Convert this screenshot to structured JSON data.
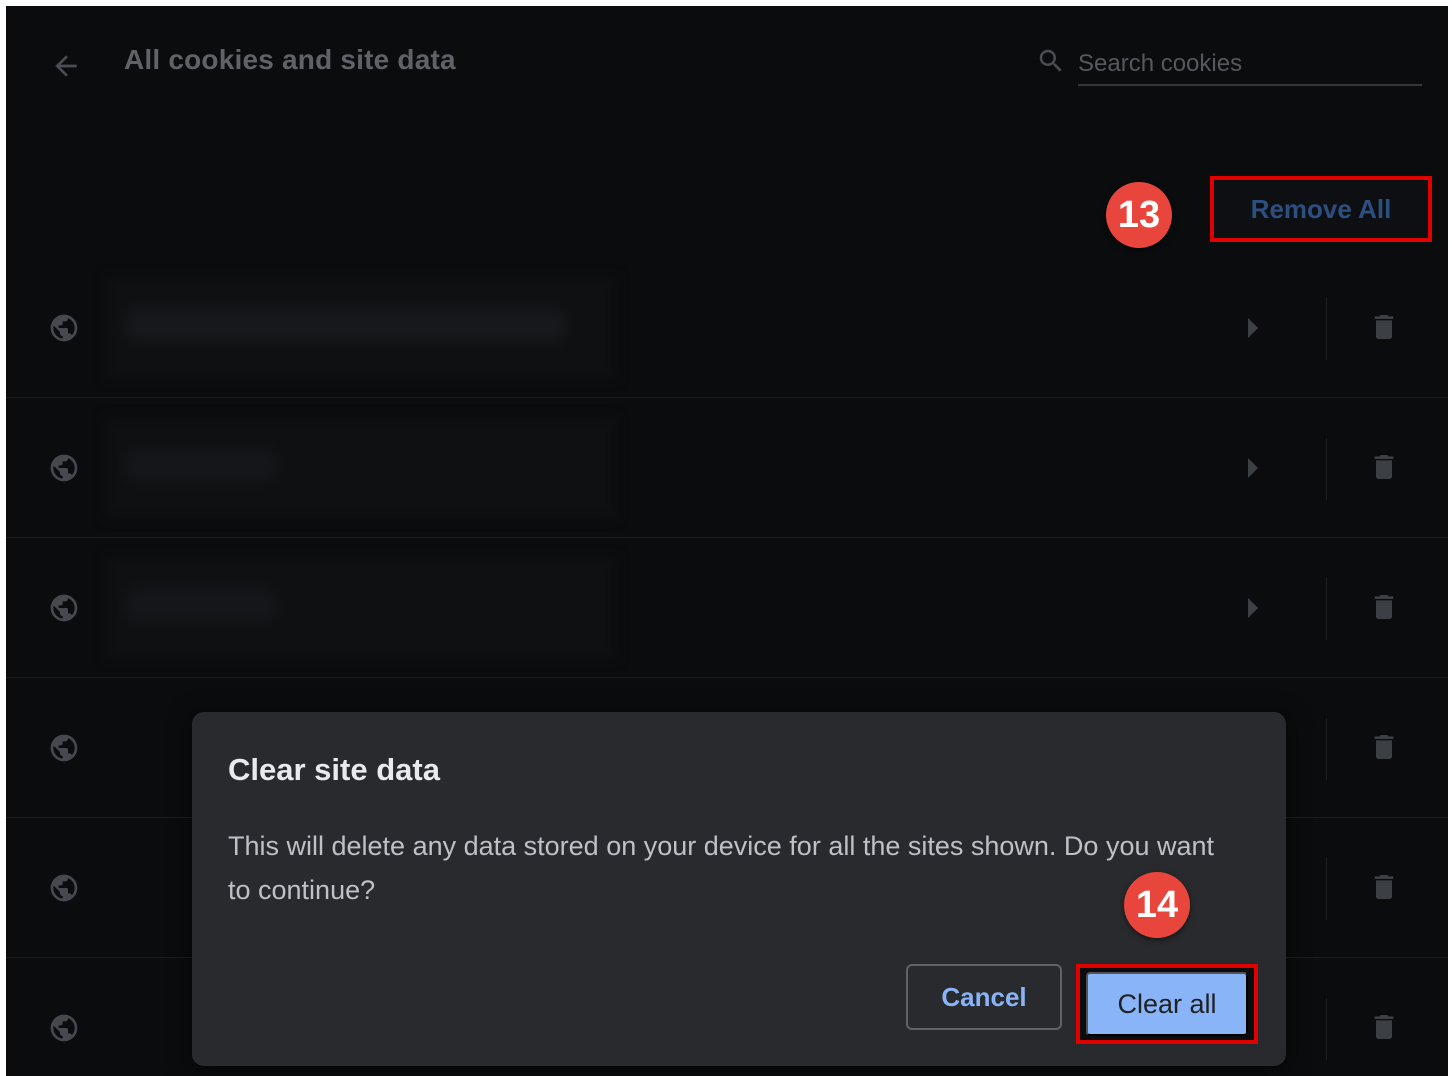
{
  "header": {
    "back_icon": "arrow-left-icon",
    "title": "All cookies and site data",
    "search_placeholder": "Search cookies"
  },
  "actions": {
    "remove_all_label": "Remove All"
  },
  "annotations": {
    "step_13": "13",
    "step_14": "14",
    "highlight_color": "#e00000",
    "badge_color": "#e8463c"
  },
  "site_list": {
    "row_count": 6,
    "row_icon": "globe-icon",
    "expand_icon": "chevron-right-icon",
    "delete_icon": "trash-icon"
  },
  "dialog": {
    "title": "Clear site data",
    "message": "This will delete any data stored on your device for all the sites shown. Do you want to continue?",
    "cancel_label": "Cancel",
    "confirm_label": "Clear all",
    "accent_color": "#8ab4f8"
  }
}
